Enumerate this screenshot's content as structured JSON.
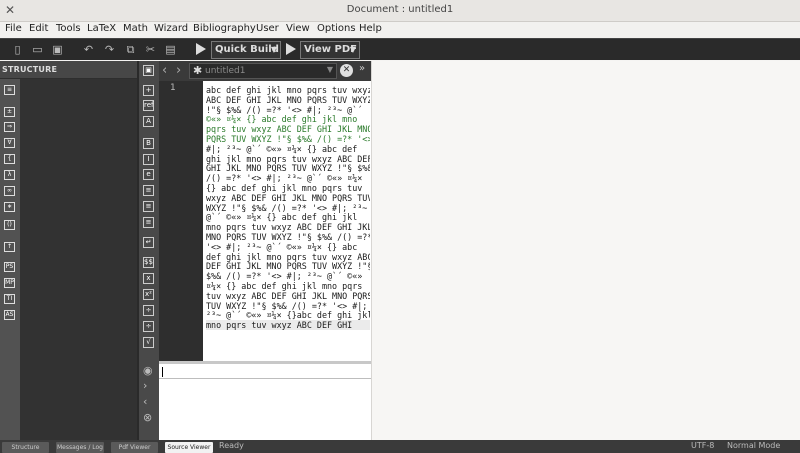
{
  "window": {
    "title": "Document : untitled1",
    "close_glyph": "✕"
  },
  "menu": [
    "File",
    "Edit",
    "Tools",
    "LaTeX",
    "Math",
    "Wizard",
    "Bibliography",
    "User",
    "View",
    "Options",
    "Help"
  ],
  "toolbar": {
    "build_label": "Quick Build",
    "view_label": "View PDF",
    "icons": [
      "new-file-icon",
      "open-folder-icon",
      "save-icon",
      "undo-icon",
      "redo-icon",
      "copy-icon",
      "cut-icon",
      "paste-icon"
    ]
  },
  "structure": {
    "title": "STRUCTURE"
  },
  "editor": {
    "tab_name": "untitled1",
    "line_number": "1",
    "lines": [
      {
        "t": "abc def ghi jkl mno pqrs tuv wxyz",
        "g": false
      },
      {
        "t": "ABC DEF GHI JKL MNO PQRS TUV WXYZ",
        "g": false
      },
      {
        "t": "!\"§ $%& /() =?* '<> #|; ²³~ @`´",
        "g": false
      },
      {
        "t": "©«» ¤¼× {} abc def ghi jkl mno",
        "g": true
      },
      {
        "t": "pqrs tuv wxyz ABC DEF GHI JKL MNO",
        "g": true
      },
      {
        "t": "PQRS TUV WXYZ !\"§ $%& /() =?* '<>",
        "g": true
      },
      {
        "t": "#|; ²³~ @`´ ©«» ¤¼× {} abc def",
        "g": false
      },
      {
        "t": "ghi jkl mno pqrs tuv wxyz ABC DEF",
        "g": false
      },
      {
        "t": "GHI JKL MNO PQRS TUV WXYZ !\"§ $%&",
        "g": false
      },
      {
        "t": "/() =?* '<> #|; ²³~ @`´ ©«» ¤¼×",
        "g": false
      },
      {
        "t": "{} abc def ghi jkl mno pqrs tuv",
        "g": false
      },
      {
        "t": "wxyz ABC DEF GHI JKL MNO PQRS TUV",
        "g": false
      },
      {
        "t": "WXYZ !\"§ $%& /() =?* '<> #|; ²³~",
        "g": false
      },
      {
        "t": "@`´ ©«» ¤¼× {} abc def ghi jkl",
        "g": false
      },
      {
        "t": "mno pqrs tuv wxyz ABC DEF GHI JKL",
        "g": false
      },
      {
        "t": "MNO PQRS TUV WXYZ !\"§ $%& /() =?*",
        "g": false
      },
      {
        "t": "'<> #|; ²³~ @`´ ©«» ¤¼× {} abc",
        "g": false
      },
      {
        "t": "def ghi jkl mno pqrs tuv wxyz ABC",
        "g": false
      },
      {
        "t": "DEF GHI JKL MNO PQRS TUV WXYZ !\"§",
        "g": false
      },
      {
        "t": "$%& /() =?* '<> #|; ²³~ @`´ ©«»",
        "g": false
      },
      {
        "t": "¤¼× {} abc def ghi jkl mno pqrs",
        "g": false
      },
      {
        "t": "tuv wxyz ABC DEF GHI JKL MNO PQRS",
        "g": false
      },
      {
        "t": "TUV WXYZ !\"§ $%& /() =?* '<> #|;",
        "g": false
      },
      {
        "t": "²³~ @`´ ©«» ¤¼× {}abc def ghi jkl",
        "g": false
      },
      {
        "t": "mno pqrs tuv wxyz ABC DEF GHI",
        "g": false
      }
    ]
  },
  "status": {
    "tabs": [
      "Structure",
      "Messages / Log",
      "Pdf Viewer",
      "Source Viewer"
    ],
    "ready": "Ready",
    "encoding": "UTF-8",
    "mode": "Normal Mode"
  }
}
